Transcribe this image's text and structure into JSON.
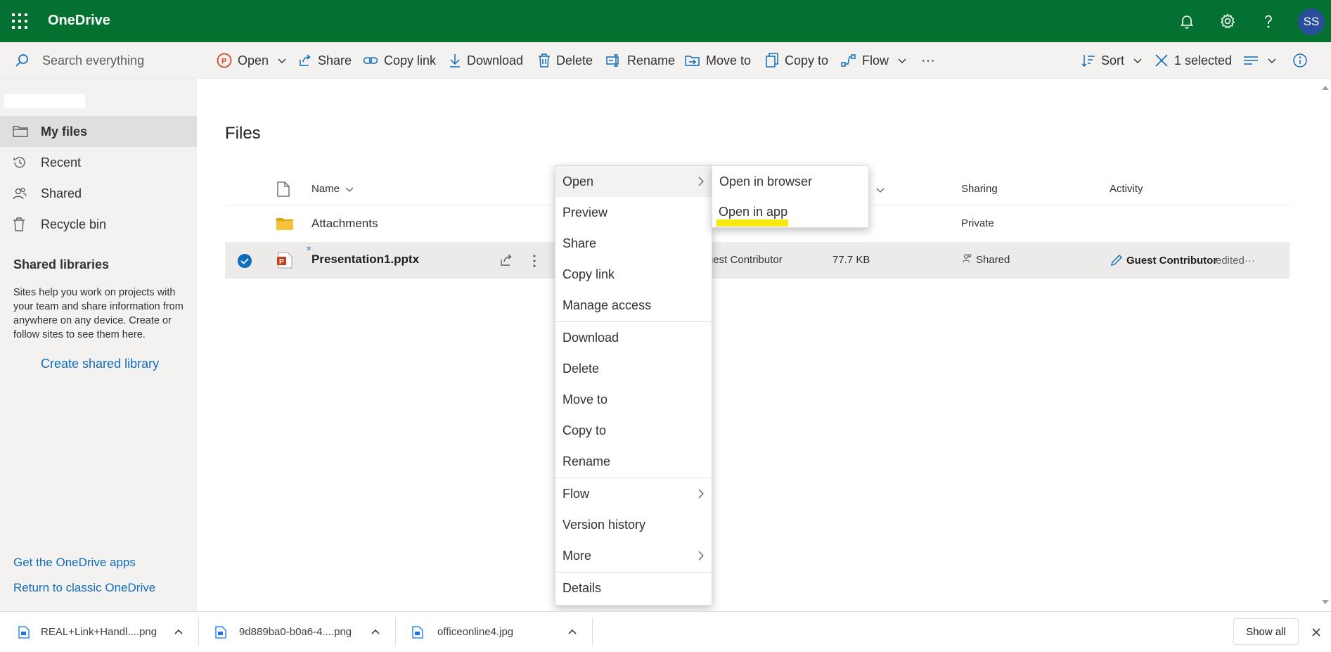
{
  "header": {
    "app_title": "OneDrive",
    "avatar_initials": "SS",
    "brand_color": "#037230"
  },
  "search": {
    "placeholder": "Search everything"
  },
  "commands": {
    "open": "Open",
    "share": "Share",
    "copy_link": "Copy link",
    "download": "Download",
    "delete": "Delete",
    "rename": "Rename",
    "move_to": "Move to",
    "copy_to": "Copy to",
    "flow": "Flow",
    "more": "···",
    "sort": "Sort",
    "selected": "1 selected"
  },
  "sidebar": {
    "items": [
      {
        "label": "My files",
        "icon": "folder-icon"
      },
      {
        "label": "Recent",
        "icon": "clock-icon"
      },
      {
        "label": "Shared",
        "icon": "people-icon"
      },
      {
        "label": "Recycle bin",
        "icon": "trash-icon"
      }
    ],
    "shared_libraries_heading": "Shared libraries",
    "shared_libraries_desc": "Sites help you work on projects with your team and share information from anywhere on any device. Create or follow sites to see them here.",
    "create_shared_library": "Create shared library",
    "get_apps": "Get the OneDrive apps",
    "return_classic": "Return to classic OneDrive"
  },
  "main": {
    "title": "Files",
    "columns": {
      "name": "Name",
      "sharing": "Sharing",
      "activity": "Activity"
    },
    "rows": [
      {
        "name": "Attachments",
        "modified_by": "",
        "size": "",
        "sharing": "Private",
        "activity_user": "",
        "activity_text": ""
      },
      {
        "name": "Presentation1.pptx",
        "modified_by": "uest Contributor",
        "size": "77.7 KB",
        "sharing": "Shared",
        "activity_user": "Guest Contributor",
        "activity_text": "edited···"
      }
    ]
  },
  "context_menu": {
    "items": [
      {
        "label": "Open",
        "has_submenu": true
      },
      {
        "label": "Preview"
      },
      {
        "label": "Share"
      },
      {
        "label": "Copy link"
      },
      {
        "label": "Manage access"
      },
      {
        "label": "Download"
      },
      {
        "label": "Delete"
      },
      {
        "label": "Move to"
      },
      {
        "label": "Copy to"
      },
      {
        "label": "Rename"
      },
      {
        "label": "Flow",
        "has_submenu": true
      },
      {
        "label": "Version history"
      },
      {
        "label": "More",
        "has_submenu": true
      },
      {
        "label": "Details"
      }
    ],
    "submenu": [
      "Open in browser",
      "Open in app"
    ]
  },
  "downloads": {
    "items": [
      "REAL+Link+Handl....png",
      "9d889ba0-b0a6-4....png",
      "officeonline4.jpg"
    ],
    "show_all": "Show all"
  }
}
